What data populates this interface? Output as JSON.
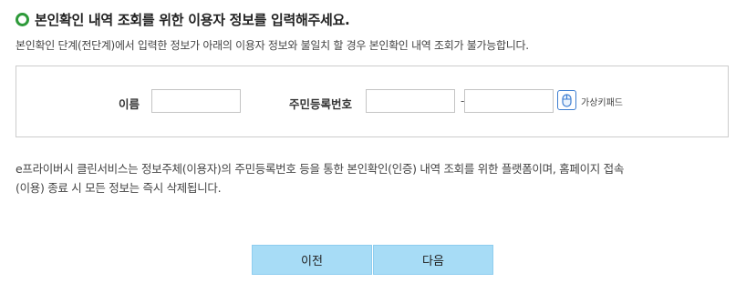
{
  "header": {
    "title": "본인확인 내역 조회를 위한 이용자 정보를 입력해주세요.",
    "description": "본인확인 단계(전단계)에서 입력한 정보가 아래의 이용자 정보와 불일치 할 경우 본인확인 내역 조회가 불가능합니다."
  },
  "form": {
    "name_label": "이름",
    "name_value": "",
    "rrn_label": "주민등록번호",
    "rrn_front_value": "",
    "rrn_separator": "-",
    "rrn_back_value": "",
    "virtual_keypad_label": "가상키패드",
    "keypad_icon": "mouse-icon"
  },
  "notice": {
    "line1": "e프라이버시 클린서비스는 정보주체(이용자)의 주민등록번호 등을 통한 본인확인(인증) 내역 조회를 위한 플랫폼이며, 홈페이지 접속",
    "line2": "(이용) 종료 시 모든 정보는 즉시 삭제됩니다."
  },
  "buttons": {
    "prev_label": "이전",
    "next_label": "다음"
  },
  "colors": {
    "bullet": "#2e9a3a",
    "button_bg": "#a7dcf6",
    "keypad_border": "#3e7ed1"
  }
}
